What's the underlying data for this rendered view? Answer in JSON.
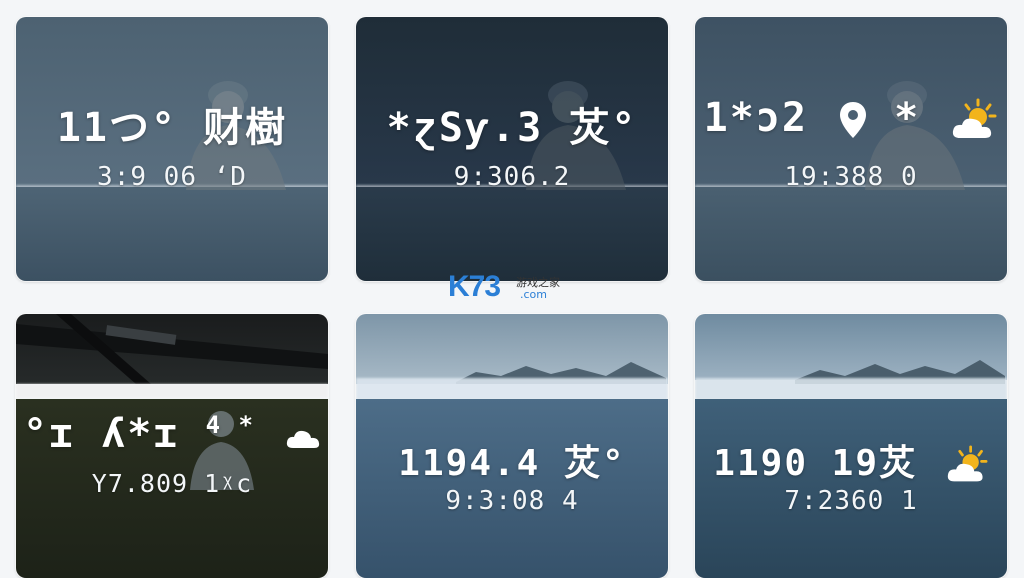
{
  "cards": [
    {
      "primary": "11つ° 财樹",
      "secondary": "3:9 06 ‘D"
    },
    {
      "primary": "*ɀSƴ.3 炗°",
      "secondary": "9:306.2"
    },
    {
      "primary": "1*ɔ2",
      "primary_suffix": "*",
      "secondary": "19:388 0",
      "icons": [
        "location-pin-icon",
        "partly-sunny-icon"
      ]
    },
    {
      "primary": "°ɪ ʎ*ɪ",
      "primary_suffix": "4 *",
      "secondary": "Y7.809 1ᵡc",
      "icons": [
        "partly-cloudy-icon"
      ]
    },
    {
      "primary": "1194.4 炗°",
      "secondary": "9:3:08 4"
    },
    {
      "primary": "1190 19炗",
      "secondary": "7:2360 1",
      "icons": [
        "partly-sunny-icon"
      ]
    }
  ],
  "watermark": {
    "logo": "K73",
    "cn": "游戏之家",
    "domain": ".com"
  },
  "colors": {
    "text": "#ffffff",
    "sun": "#f2b41c",
    "cloud": "#ffffff",
    "brand": "#2b7fd6"
  }
}
